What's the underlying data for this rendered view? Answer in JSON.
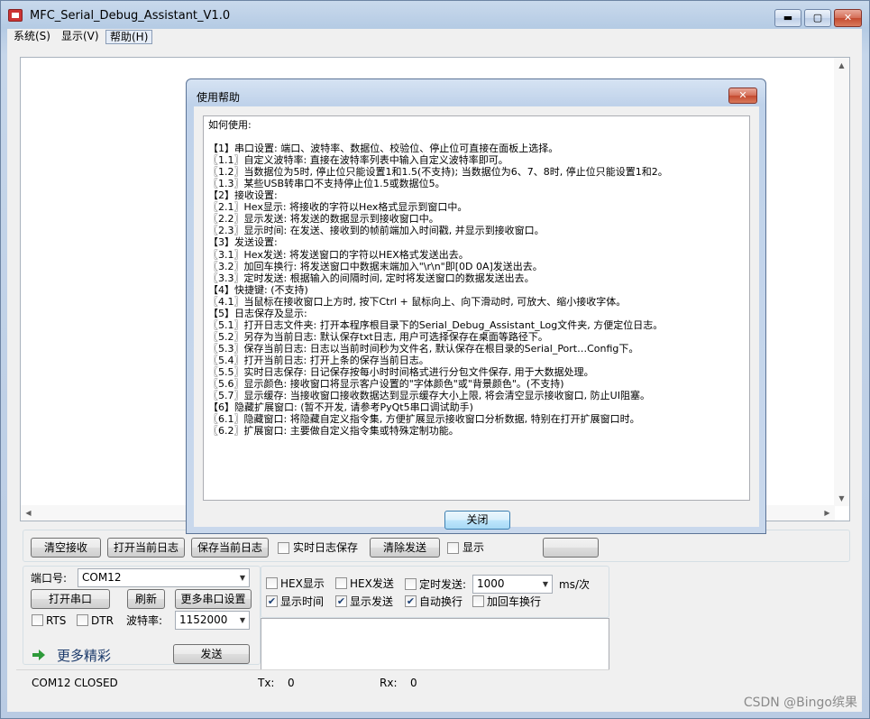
{
  "window": {
    "title": "MFC_Serial_Debug_Assistant_V1.0",
    "min": "▬",
    "max": "▢",
    "close": "✕"
  },
  "menu": [
    {
      "label": "系统(S)"
    },
    {
      "label": "显示(V)"
    },
    {
      "label": "帮助(H)"
    }
  ],
  "toolbar": {
    "clear_recv": "清空接收",
    "open_log": "打开当前日志",
    "save_log": "保存当前日志",
    "realtime_save": "实时日志保存",
    "clear_send": "清除发送",
    "show": "显示"
  },
  "serial": {
    "port_label": "端口号:",
    "port_value": "COM12",
    "open_port": "打开串口",
    "refresh": "刷新",
    "more_ports": "更多串口设置",
    "rts": "RTS",
    "dtr": "DTR",
    "baud_label": "波特率:",
    "baud_value": "1152000"
  },
  "options": {
    "hex_display": "HEX显示",
    "hex_send": "HEX发送",
    "timed_send": "定时发送:",
    "interval_value": "1000",
    "interval_unit": "ms/次",
    "show_time": "显示时间",
    "show_send": "显示发送",
    "auto_newline": "自动换行",
    "add_crlf": "加回车换行"
  },
  "more": {
    "label": "更多精彩",
    "send": "发送"
  },
  "status": {
    "port": "COM12 CLOSED",
    "tx_label": "Tx:",
    "tx_value": "0",
    "rx_label": "Rx:",
    "rx_value": "0"
  },
  "dialog": {
    "title": "使用帮助",
    "close": "✕",
    "ok": "关闭",
    "lines": [
      "如何使用:",
      "",
      "【1】串口设置: 端口、波特率、数据位、校验位、停止位可直接在面板上选择。",
      "〖1.1〗自定义波特率: 直接在波特率列表中输入自定义波特率即可。",
      "〖1.2〗当数据位为5时, 停止位只能设置1和1.5(不支持); 当数据位为6、7、8时, 停止位只能设置1和2。",
      "〖1.3〗某些USB转串口不支持停止位1.5或数据位5。",
      "【2】接收设置:",
      "〖2.1〗Hex显示: 将接收的字符以Hex格式显示到窗口中。",
      "〖2.2〗显示发送: 将发送的数据显示到接收窗口中。",
      "〖2.3〗显示时间: 在发送、接收到的帧前端加入时间戳, 并显示到接收窗口。",
      "【3】发送设置:",
      "〖3.1〗Hex发送: 将发送窗口的字符以HEX格式发送出去。",
      "〖3.2〗加回车换行: 将发送窗口中数据末端加入\"\\r\\n\"即[0D 0A]发送出去。",
      "〖3.3〗定时发送: 根据输入的间隔时间, 定时将发送窗口的数据发送出去。",
      "【4】快捷键: (不支持)",
      "〖4.1〗当鼠标在接收窗口上方时, 按下Ctrl + 鼠标向上、向下滑动时, 可放大、缩小接收字体。",
      "【5】日志保存及显示:",
      "〖5.1〗打开日志文件夹: 打开本程序根目录下的Serial_Debug_Assistant_Log文件夹, 方便定位日志。",
      "〖5.2〗另存为当前日志: 默认保存txt日志, 用户可选择保存在桌面等路径下。",
      "〖5.3〗保存当前日志: 日志以当前时间秒为文件名, 默认保存在根目录的Serial_Port…Config下。",
      "〖5.4〗打开当前日志: 打开上条的保存当前日志。",
      "〖5.5〗实时日志保存: 日记保存按每小时时间格式进行分包文件保存, 用于大数据处理。",
      "〖5.6〗显示颜色: 接收窗口将显示客户设置的\"字体颜色\"或\"背景颜色\"。(不支持)",
      "〖5.7〗显示缓存: 当接收窗口接收数据达到显示缓存大小上限, 将会清空显示接收窗口, 防止UI阻塞。",
      "【6】隐藏扩展窗口: (暂不开发, 请参考PyQt5串口调试助手)",
      "〖6.1〗隐藏窗口: 将隐藏自定义指令集, 方便扩展显示接收窗口分析数据, 特别在打开扩展窗口时。",
      "〖6.2〗扩展窗口: 主要做自定义指令集或特殊定制功能。"
    ]
  },
  "watermark": "CSDN @Bingo缤果"
}
